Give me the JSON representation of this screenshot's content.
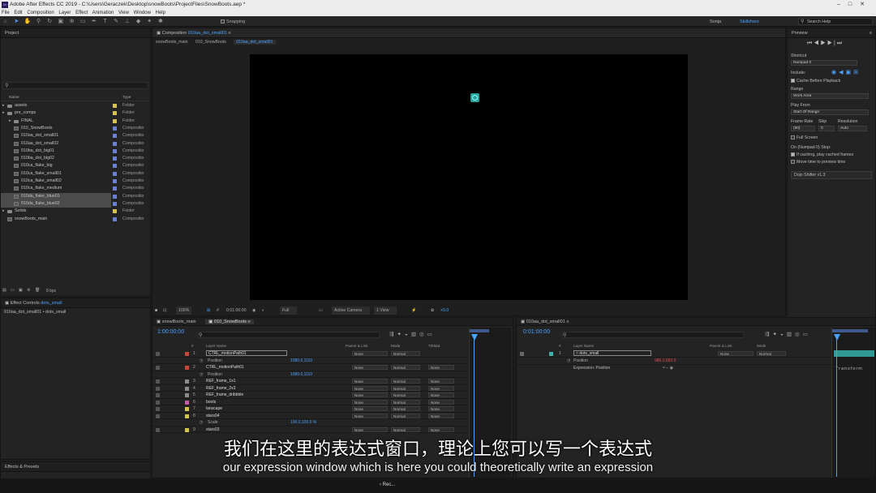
{
  "window": {
    "title": "Adobe After Effects CC 2019 - C:\\Users\\Geraczek\\Desktop\\snowBoots\\ProjectFiles\\SnowBoots.aep *"
  },
  "menu": [
    "File",
    "Edit",
    "Composition",
    "Layer",
    "Effect",
    "Animation",
    "View",
    "Window",
    "Help"
  ],
  "toolbar": {
    "snapping": "Snapping",
    "user": "Sonja",
    "workspace": "Skillshare",
    "search_placeholder": "Search Help"
  },
  "project": {
    "tab": "Project",
    "col_name": "Name",
    "col_type": "Type",
    "bpc": "8 bpc",
    "items": [
      {
        "name": "assets",
        "type": "Folder",
        "kind": "folder",
        "label": "#d4c34a",
        "indent": 0,
        "selected": false
      },
      {
        "name": "pre_comps",
        "type": "Folder",
        "kind": "folder",
        "label": "#d4c34a",
        "indent": 0,
        "selected": false
      },
      {
        "name": "FINAL",
        "type": "Folder",
        "kind": "folder",
        "label": "#d4c34a",
        "indent": 1,
        "selected": false
      },
      {
        "name": "010_SnowBoots",
        "type": "Compositio",
        "kind": "comp",
        "label": "#6b7fd6",
        "indent": 1,
        "selected": false
      },
      {
        "name": "010aa_dot_small01",
        "type": "Compositio",
        "kind": "comp",
        "label": "#6b7fd6",
        "indent": 1,
        "selected": false
      },
      {
        "name": "010aa_dot_small02",
        "type": "Compositio",
        "kind": "comp",
        "label": "#6b7fd6",
        "indent": 1,
        "selected": false
      },
      {
        "name": "010ba_dot_big01",
        "type": "Compositio",
        "kind": "comp",
        "label": "#6b7fd6",
        "indent": 1,
        "selected": false
      },
      {
        "name": "010ba_dot_big02",
        "type": "Compositio",
        "kind": "comp",
        "label": "#6b7fd6",
        "indent": 1,
        "selected": false
      },
      {
        "name": "010ca_flake_big",
        "type": "Compositio",
        "kind": "comp",
        "label": "#6b7fd6",
        "indent": 1,
        "selected": false
      },
      {
        "name": "010ca_flake_small01",
        "type": "Compositio",
        "kind": "comp",
        "label": "#6b7fd6",
        "indent": 1,
        "selected": false
      },
      {
        "name": "010ca_flake_small02",
        "type": "Compositio",
        "kind": "comp",
        "label": "#6b7fd6",
        "indent": 1,
        "selected": false
      },
      {
        "name": "010ca_flake_medium",
        "type": "Compositio",
        "kind": "comp",
        "label": "#6b7fd6",
        "indent": 1,
        "selected": false
      },
      {
        "name": "010da_flake_blue01",
        "type": "Compositio",
        "kind": "comp",
        "label": "#6b7fd6",
        "indent": 1,
        "selected": true
      },
      {
        "name": "010da_flake_blue02",
        "type": "Compositio",
        "kind": "comp",
        "label": "#6b7fd6",
        "indent": 1,
        "selected": true
      },
      {
        "name": "Solids",
        "type": "Folder",
        "kind": "folder",
        "label": "#d4c34a",
        "indent": 0,
        "selected": false
      },
      {
        "name": "snowBoots_main",
        "type": "Compositio",
        "kind": "comp",
        "label": "#6b7fd6",
        "indent": 0,
        "selected": false
      }
    ]
  },
  "effect_controls": {
    "tab": "Effect Controls",
    "target": "dots_small",
    "breadcrumb": "010aa_dot_small01 • dots_small"
  },
  "effects_presets": {
    "tab": "Effects & Presets"
  },
  "composition": {
    "tab_prefix": "Composition",
    "tab_name": "010aa_dot_small01",
    "sub_tabs": [
      "snowBoots_main",
      "010_SnowBoots",
      "010aa_dot_small01"
    ],
    "zoom": "100%",
    "timecode": "0;01:00:00",
    "resolution": "Full",
    "camera": "Active Camera",
    "views": "1 View",
    "exposure": "+0.0"
  },
  "timeline_left": {
    "tabs": [
      "snowBoots_main",
      "010_SnowBoots"
    ],
    "timecode": "1:00:00:00",
    "headers": {
      "num": "#",
      "layer_name": "Layer Name",
      "parent": "Parent & Link",
      "mode": "Mode",
      "trkmat": "TrkMat"
    },
    "rows": [
      {
        "num": "1",
        "name": "CTRL_motionPath01",
        "label": "#c9463d",
        "parent": "None",
        "mode": "Normal",
        "trk": "",
        "bar": "#a8423d",
        "boxed": true
      },
      {
        "num": "",
        "name": "Position",
        "value": "1080.0,1110",
        "sub": true
      },
      {
        "num": "2",
        "name": "CTRL_motionPath01",
        "label": "#c9463d",
        "parent": "None",
        "mode": "Normal",
        "trk": "None",
        "bar": "#a8423d"
      },
      {
        "num": "",
        "name": "Position",
        "value": "1080.0,1110",
        "sub": true
      },
      {
        "num": "3",
        "name": "REF_frame_1x1",
        "label": "#8a8a8a",
        "parent": "None",
        "mode": "Normal",
        "trk": "None",
        "bar": "#6f6f6f"
      },
      {
        "num": "4",
        "name": "REF_frame_2x3",
        "label": "#8a8a8a",
        "parent": "None",
        "mode": "Normal",
        "trk": "None",
        "bar": "#6f6f6f"
      },
      {
        "num": "5",
        "name": "REF_frame_dribbble",
        "label": "#8a8a8a",
        "parent": "None",
        "mode": "Normal",
        "trk": "None",
        "bar": "#6f6f6f"
      },
      {
        "num": "6",
        "name": "boots",
        "label": "#c85aa8",
        "parent": "None",
        "mode": "Normal",
        "trk": "None",
        "bar": "#b84f9c"
      },
      {
        "num": "7",
        "name": "lanscape",
        "label": "#d4c34a",
        "parent": "None",
        "mode": "Normal",
        "trk": "None",
        "bar": "#b3a640"
      },
      {
        "num": "8",
        "name": "stars04",
        "label": "#d4c34a",
        "parent": "None",
        "mode": "Normal",
        "trk": "None",
        "bar": "#b3a640"
      },
      {
        "num": "",
        "name": "Scale",
        "value": "100.0,100.0 %",
        "sub": true
      },
      {
        "num": "9",
        "name": "stars03",
        "label": "#d4c34a",
        "parent": "None",
        "mode": "Normal",
        "trk": "None",
        "bar": "#b3a640"
      }
    ]
  },
  "timeline_right": {
    "tab": "010aa_dot_small01",
    "timecode": "0:01:00:00",
    "rows": [
      {
        "num": "1",
        "name": "dots_small",
        "label": "#3fb0a9",
        "parent": "None",
        "mode": "Normal"
      },
      {
        "num": "",
        "name": "Position",
        "value": "986.0,582.0",
        "sub": true
      },
      {
        "num": "",
        "name": "Expression: Position",
        "sub": true
      }
    ],
    "transform_label": "Transform"
  },
  "preview": {
    "tab": "Preview",
    "shortcut_label": "Shortcut",
    "shortcut": "Numpad 0",
    "include": "Include:",
    "cache": "Cache Before Playback",
    "range_label": "Range",
    "range": "Work Area",
    "playfrom_label": "Play From",
    "playfrom": "Start Of Range",
    "framerate_label": "Frame Rate",
    "skip_label": "Skip",
    "resolution_label": "Resolution",
    "framerate": "(60)",
    "skip": "0",
    "resolution": "Auto",
    "fullscreen": "Full Screen",
    "on_stop": "On (Numpad 0) Stop:",
    "if_caching": "If caching, play cached frames",
    "move_time": "Move time to preview time",
    "plugin": "Dojo Shifter v1.3"
  },
  "subtitles": {
    "cn": "我们在这里的表达式窗口，理论上您可以写一个表达式",
    "en": "our expression window which is here you could theoretically write an expression"
  },
  "taskbar": {
    "rec": "‹ Rec..."
  }
}
